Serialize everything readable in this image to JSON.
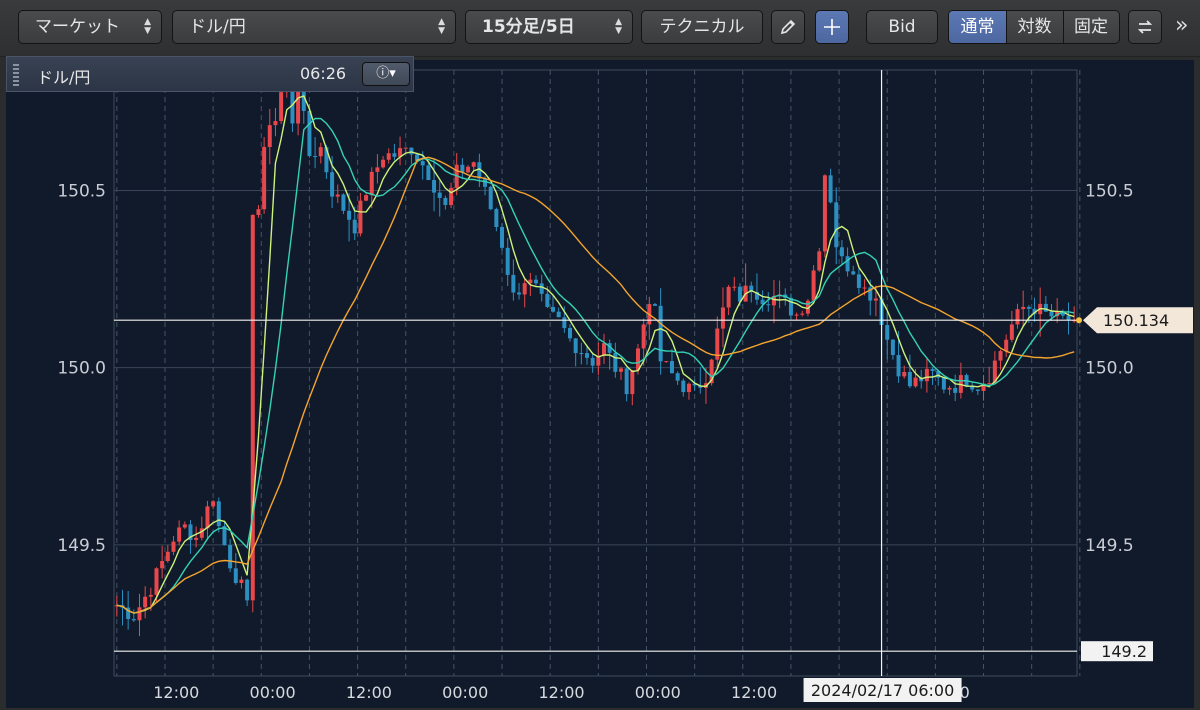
{
  "toolbar": {
    "market_select": "マーケット",
    "pair_select": "ドル/円",
    "period_select": "15分足/5日",
    "technical_button": "テクニカル",
    "pencil_icon": "pencil-icon",
    "crosshair_icon": "crosshair-icon",
    "bid_button": "Bid",
    "scale_modes": [
      "通常",
      "対数",
      "固定"
    ],
    "active_scale_mode": "通常",
    "swap_icon": "swap-icon",
    "more_icon": "»"
  },
  "info_bar": {
    "pair": "ドル/円",
    "time": "06:26",
    "info_icon": "info-icon"
  },
  "colors": {
    "background": "#111a2a",
    "up_candle": "#e8474b",
    "down_candle": "#2c8fc2",
    "ma_short": "#ccf27a",
    "ma_mid": "#35d2b4",
    "ma_long": "#f5a42f",
    "accent": "#5c79b4"
  },
  "chart_data": {
    "type": "candlestick",
    "pair": "ドル/円",
    "timeframe": "15分足/5日",
    "ylim": [
      149.13,
      150.84
    ],
    "yticks": [
      149.5,
      150.0,
      150.5
    ],
    "ytick_labels": [
      "149.5",
      "150.0",
      "150.5"
    ],
    "xtick_labels": [
      "12:00",
      "00:00",
      "12:00",
      "00:00",
      "12:00",
      "00:00",
      "12:00",
      "00:00"
    ],
    "xtick_positions": [
      10.5,
      27.5,
      44.5,
      61.5,
      78.5,
      95.5,
      112.5,
      146.5
    ],
    "current_price": 150.134,
    "current_price_label": "150.134",
    "marker_price": 149.2,
    "marker_price_label": "149.2",
    "crosshair_label": "2024/02/17 06:00",
    "crosshair_x": 135,
    "x_count": 170,
    "close_keypoints": [
      [
        0,
        149.33
      ],
      [
        3,
        149.3
      ],
      [
        6,
        149.38
      ],
      [
        10,
        149.52
      ],
      [
        12,
        149.55
      ],
      [
        14,
        149.52
      ],
      [
        16,
        149.6
      ],
      [
        17,
        149.64
      ],
      [
        18,
        149.55
      ],
      [
        20,
        149.45
      ],
      [
        22,
        149.38
      ],
      [
        23,
        149.32
      ],
      [
        23.5,
        149.9
      ],
      [
        24,
        150.45
      ],
      [
        25,
        150.45
      ],
      [
        26,
        150.6
      ],
      [
        27,
        150.7
      ],
      [
        28,
        150.7
      ],
      [
        30,
        150.85
      ],
      [
        31,
        150.7
      ],
      [
        32,
        150.8
      ],
      [
        34,
        150.6
      ],
      [
        36,
        150.62
      ],
      [
        38,
        150.5
      ],
      [
        40,
        150.45
      ],
      [
        42,
        150.4
      ],
      [
        44,
        150.5
      ],
      [
        47,
        150.6
      ],
      [
        49,
        150.6
      ],
      [
        52,
        150.62
      ],
      [
        55,
        150.55
      ],
      [
        58,
        150.45
      ],
      [
        60,
        150.55
      ],
      [
        63,
        150.58
      ],
      [
        66,
        150.45
      ],
      [
        68,
        150.35
      ],
      [
        70,
        150.2
      ],
      [
        72,
        150.25
      ],
      [
        74,
        150.22
      ],
      [
        76,
        150.15
      ],
      [
        78,
        150.13
      ],
      [
        80,
        150.08
      ],
      [
        82,
        150.05
      ],
      [
        84,
        150.02
      ],
      [
        86,
        150.06
      ],
      [
        88,
        150.0
      ],
      [
        90,
        149.95
      ],
      [
        92,
        150.05
      ],
      [
        94,
        150.2
      ],
      [
        95,
        150.15
      ],
      [
        96,
        150.02
      ],
      [
        98,
        149.98
      ],
      [
        100,
        149.95
      ],
      [
        102,
        149.93
      ],
      [
        104,
        149.98
      ],
      [
        106,
        150.1
      ],
      [
        108,
        150.22
      ],
      [
        110,
        150.2
      ],
      [
        112,
        150.23
      ],
      [
        114,
        150.2
      ],
      [
        116,
        150.2
      ],
      [
        118,
        150.18
      ],
      [
        120,
        150.15
      ],
      [
        122,
        150.2
      ],
      [
        124,
        150.35
      ],
      [
        125,
        150.55
      ],
      [
        126,
        150.48
      ],
      [
        127,
        150.35
      ],
      [
        128,
        150.3
      ],
      [
        130,
        150.28
      ],
      [
        132,
        150.22
      ],
      [
        134,
        150.2
      ],
      [
        136,
        150.08
      ],
      [
        138,
        150.0
      ],
      [
        140,
        149.95
      ],
      [
        142,
        149.97
      ],
      [
        144,
        149.98
      ],
      [
        146,
        149.95
      ],
      [
        148,
        149.95
      ],
      [
        150,
        149.97
      ],
      [
        152,
        149.95
      ],
      [
        154,
        149.98
      ],
      [
        156,
        150.05
      ],
      [
        158,
        150.12
      ],
      [
        160,
        150.17
      ],
      [
        162,
        150.17
      ],
      [
        164,
        150.15
      ],
      [
        166,
        150.14
      ],
      [
        169,
        150.134
      ]
    ],
    "ma_periods": [
      5,
      10,
      30
    ]
  }
}
